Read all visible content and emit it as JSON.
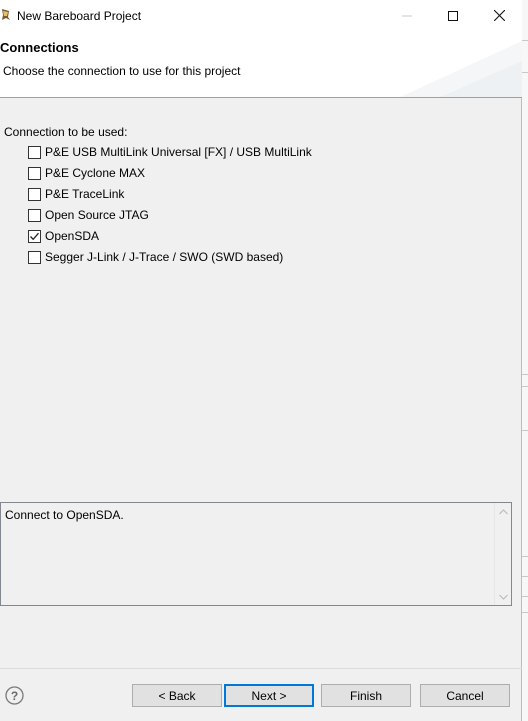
{
  "window": {
    "title": "New Bareboard Project"
  },
  "header": {
    "title": "Connections",
    "description": "Choose the connection to use for this project"
  },
  "connections": {
    "label": "Connection to be used:",
    "options": [
      {
        "label": "P&E USB MultiLink Universal [FX] / USB MultiLink",
        "checked": false
      },
      {
        "label": "P&E Cyclone MAX",
        "checked": false
      },
      {
        "label": "P&E TraceLink",
        "checked": false
      },
      {
        "label": "Open Source JTAG",
        "checked": false
      },
      {
        "label": "OpenSDA",
        "checked": true
      },
      {
        "label": "Segger J-Link / J-Trace / SWO (SWD based)",
        "checked": false
      }
    ]
  },
  "description_box": {
    "text": "Connect to OpenSDA."
  },
  "footer": {
    "back_label": "< Back",
    "next_label": "Next >",
    "finish_label": "Finish",
    "cancel_label": "Cancel"
  },
  "colors": {
    "dialog_bg": "#f0f0f0",
    "default_button_border": "#0078d7"
  }
}
